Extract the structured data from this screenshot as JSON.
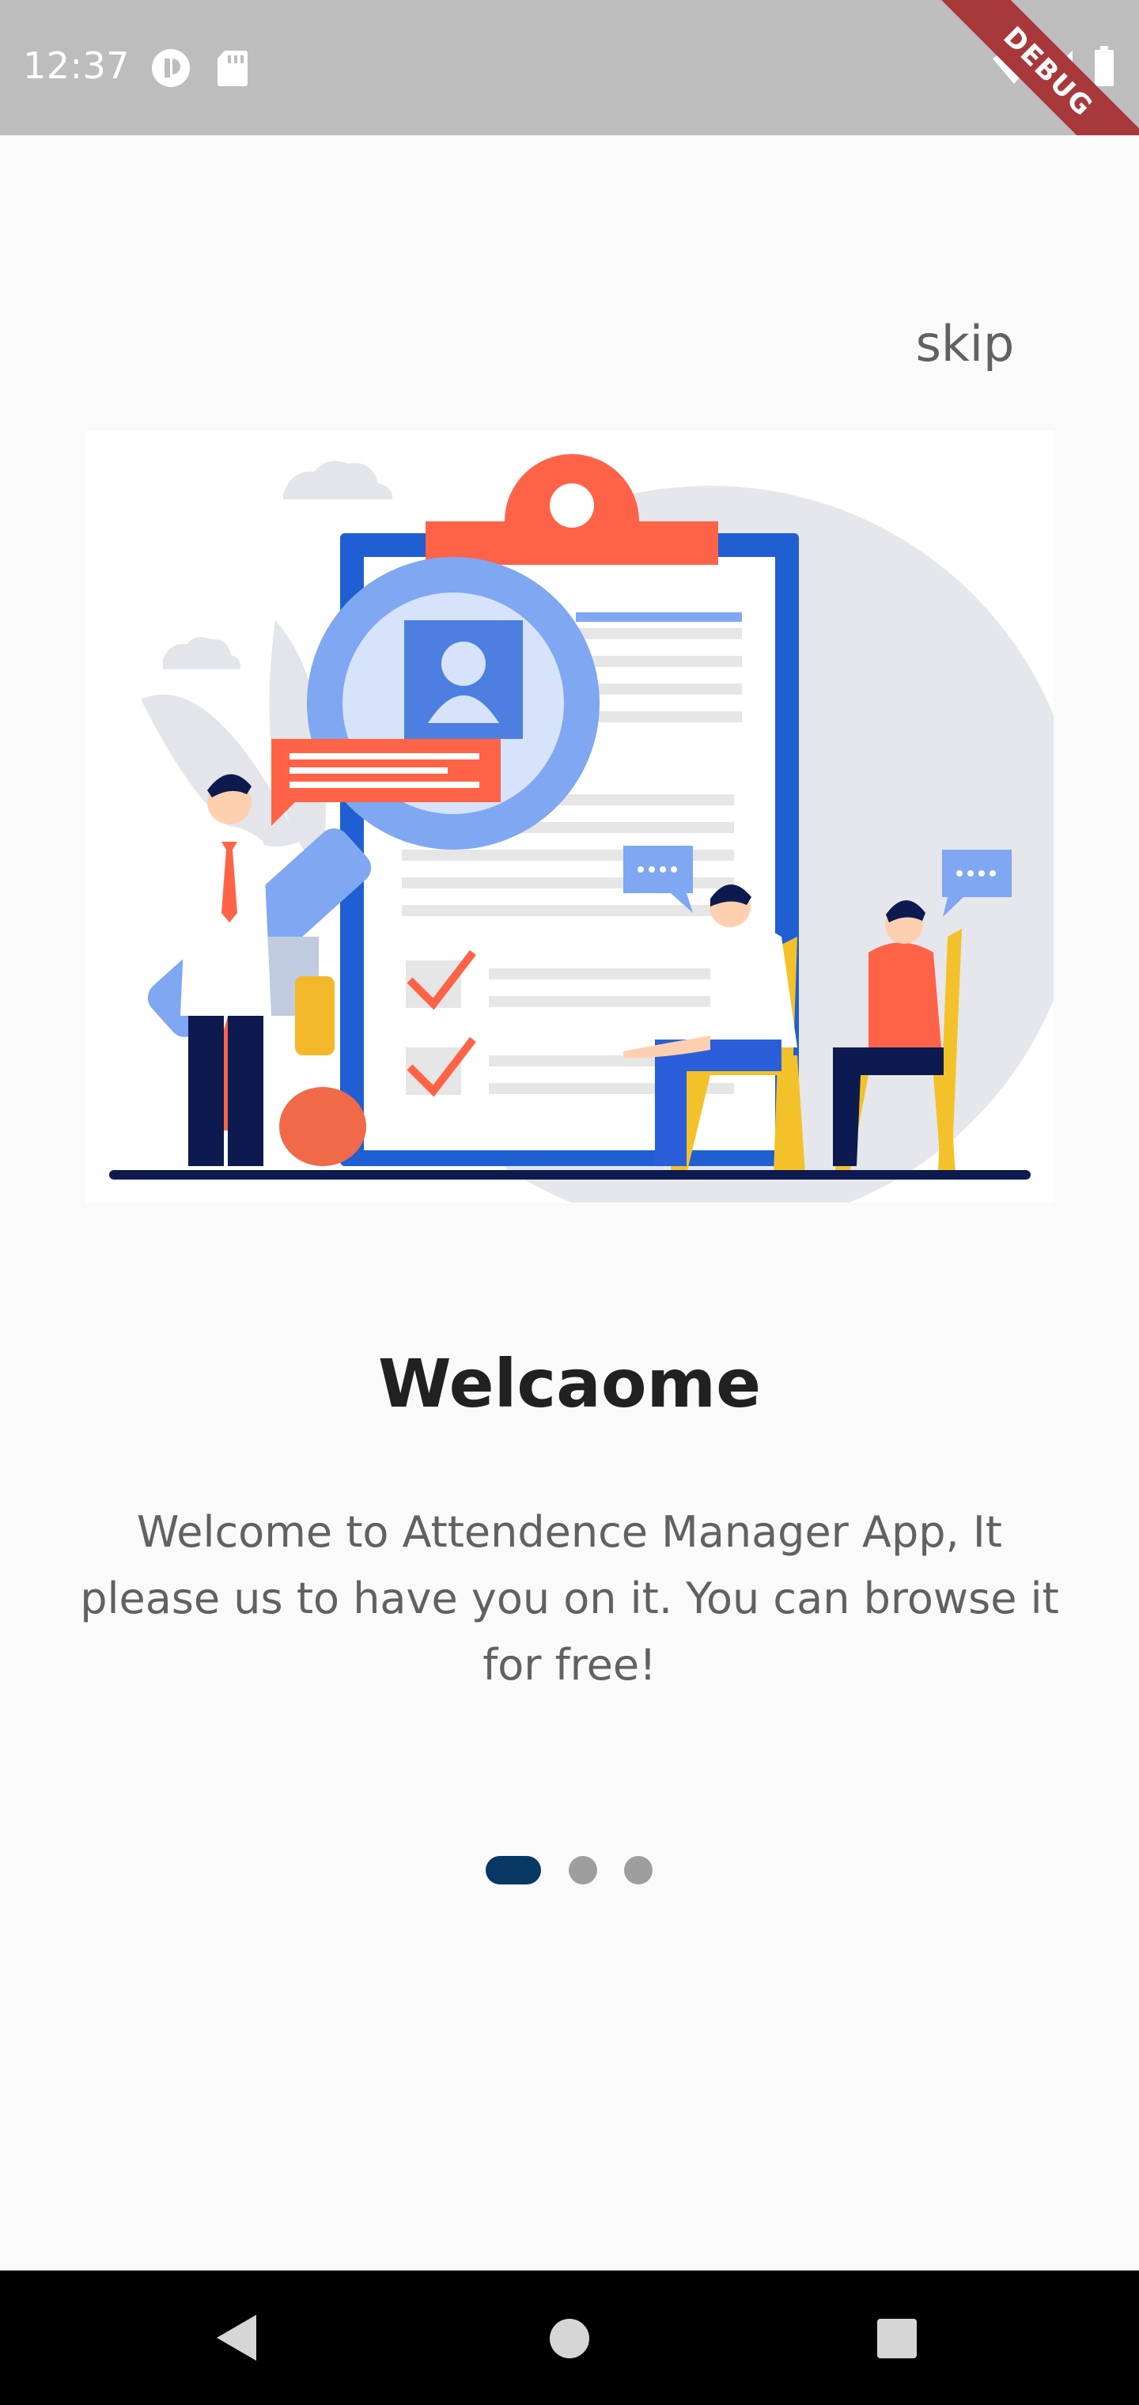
{
  "status_bar": {
    "time": "12:37",
    "icons": [
      "notification-icon",
      "sd-card-icon",
      "wifi-icon",
      "signal-icon",
      "battery-icon"
    ],
    "debug_banner": "DEBUG"
  },
  "onboarding": {
    "skip_label": "skip",
    "title": "Welcaome",
    "description": "Welcome to Attendence Manager App, It please us to have you on it. You can browse it for free!",
    "page_count": 3,
    "current_page": 1
  },
  "nav_bar": {
    "buttons": [
      "back",
      "home",
      "recents"
    ]
  },
  "colors": {
    "status_bar": "#bdbdbd",
    "background": "#fafafa",
    "indicator_active": "#073763",
    "indicator_inactive": "#9e9e9e",
    "illustration_blue": "#2b5fd9",
    "illustration_orange": "#ff6347"
  }
}
